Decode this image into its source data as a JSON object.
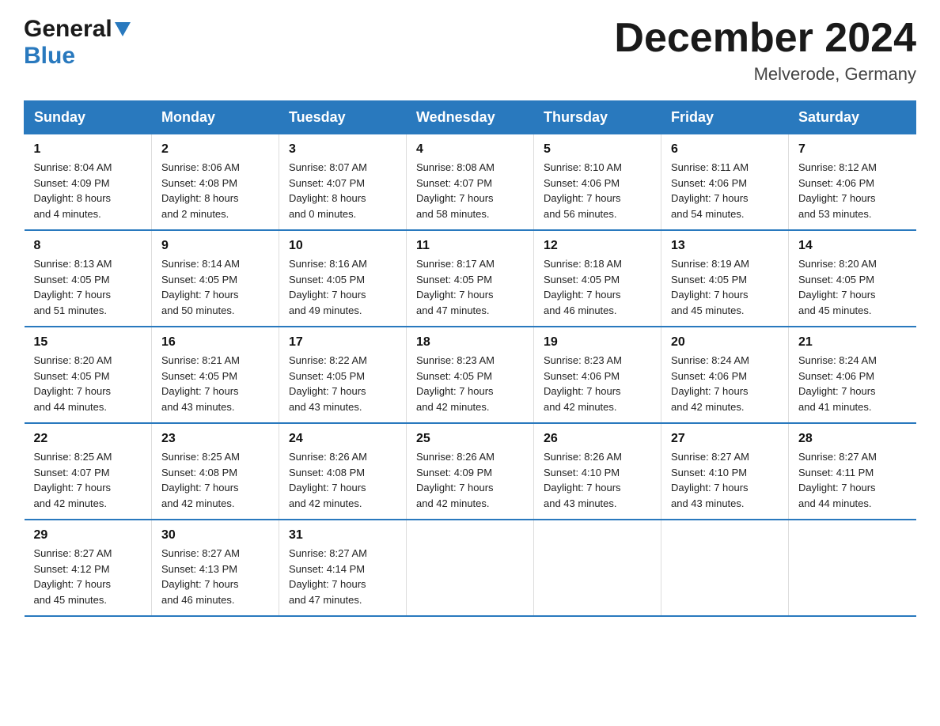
{
  "logo": {
    "general": "General",
    "blue": "Blue"
  },
  "title": "December 2024",
  "location": "Melverode, Germany",
  "weekdays": [
    "Sunday",
    "Monday",
    "Tuesday",
    "Wednesday",
    "Thursday",
    "Friday",
    "Saturday"
  ],
  "weeks": [
    [
      {
        "day": "1",
        "info": "Sunrise: 8:04 AM\nSunset: 4:09 PM\nDaylight: 8 hours\nand 4 minutes."
      },
      {
        "day": "2",
        "info": "Sunrise: 8:06 AM\nSunset: 4:08 PM\nDaylight: 8 hours\nand 2 minutes."
      },
      {
        "day": "3",
        "info": "Sunrise: 8:07 AM\nSunset: 4:07 PM\nDaylight: 8 hours\nand 0 minutes."
      },
      {
        "day": "4",
        "info": "Sunrise: 8:08 AM\nSunset: 4:07 PM\nDaylight: 7 hours\nand 58 minutes."
      },
      {
        "day": "5",
        "info": "Sunrise: 8:10 AM\nSunset: 4:06 PM\nDaylight: 7 hours\nand 56 minutes."
      },
      {
        "day": "6",
        "info": "Sunrise: 8:11 AM\nSunset: 4:06 PM\nDaylight: 7 hours\nand 54 minutes."
      },
      {
        "day": "7",
        "info": "Sunrise: 8:12 AM\nSunset: 4:06 PM\nDaylight: 7 hours\nand 53 minutes."
      }
    ],
    [
      {
        "day": "8",
        "info": "Sunrise: 8:13 AM\nSunset: 4:05 PM\nDaylight: 7 hours\nand 51 minutes."
      },
      {
        "day": "9",
        "info": "Sunrise: 8:14 AM\nSunset: 4:05 PM\nDaylight: 7 hours\nand 50 minutes."
      },
      {
        "day": "10",
        "info": "Sunrise: 8:16 AM\nSunset: 4:05 PM\nDaylight: 7 hours\nand 49 minutes."
      },
      {
        "day": "11",
        "info": "Sunrise: 8:17 AM\nSunset: 4:05 PM\nDaylight: 7 hours\nand 47 minutes."
      },
      {
        "day": "12",
        "info": "Sunrise: 8:18 AM\nSunset: 4:05 PM\nDaylight: 7 hours\nand 46 minutes."
      },
      {
        "day": "13",
        "info": "Sunrise: 8:19 AM\nSunset: 4:05 PM\nDaylight: 7 hours\nand 45 minutes."
      },
      {
        "day": "14",
        "info": "Sunrise: 8:20 AM\nSunset: 4:05 PM\nDaylight: 7 hours\nand 45 minutes."
      }
    ],
    [
      {
        "day": "15",
        "info": "Sunrise: 8:20 AM\nSunset: 4:05 PM\nDaylight: 7 hours\nand 44 minutes."
      },
      {
        "day": "16",
        "info": "Sunrise: 8:21 AM\nSunset: 4:05 PM\nDaylight: 7 hours\nand 43 minutes."
      },
      {
        "day": "17",
        "info": "Sunrise: 8:22 AM\nSunset: 4:05 PM\nDaylight: 7 hours\nand 43 minutes."
      },
      {
        "day": "18",
        "info": "Sunrise: 8:23 AM\nSunset: 4:05 PM\nDaylight: 7 hours\nand 42 minutes."
      },
      {
        "day": "19",
        "info": "Sunrise: 8:23 AM\nSunset: 4:06 PM\nDaylight: 7 hours\nand 42 minutes."
      },
      {
        "day": "20",
        "info": "Sunrise: 8:24 AM\nSunset: 4:06 PM\nDaylight: 7 hours\nand 42 minutes."
      },
      {
        "day": "21",
        "info": "Sunrise: 8:24 AM\nSunset: 4:06 PM\nDaylight: 7 hours\nand 41 minutes."
      }
    ],
    [
      {
        "day": "22",
        "info": "Sunrise: 8:25 AM\nSunset: 4:07 PM\nDaylight: 7 hours\nand 42 minutes."
      },
      {
        "day": "23",
        "info": "Sunrise: 8:25 AM\nSunset: 4:08 PM\nDaylight: 7 hours\nand 42 minutes."
      },
      {
        "day": "24",
        "info": "Sunrise: 8:26 AM\nSunset: 4:08 PM\nDaylight: 7 hours\nand 42 minutes."
      },
      {
        "day": "25",
        "info": "Sunrise: 8:26 AM\nSunset: 4:09 PM\nDaylight: 7 hours\nand 42 minutes."
      },
      {
        "day": "26",
        "info": "Sunrise: 8:26 AM\nSunset: 4:10 PM\nDaylight: 7 hours\nand 43 minutes."
      },
      {
        "day": "27",
        "info": "Sunrise: 8:27 AM\nSunset: 4:10 PM\nDaylight: 7 hours\nand 43 minutes."
      },
      {
        "day": "28",
        "info": "Sunrise: 8:27 AM\nSunset: 4:11 PM\nDaylight: 7 hours\nand 44 minutes."
      }
    ],
    [
      {
        "day": "29",
        "info": "Sunrise: 8:27 AM\nSunset: 4:12 PM\nDaylight: 7 hours\nand 45 minutes."
      },
      {
        "day": "30",
        "info": "Sunrise: 8:27 AM\nSunset: 4:13 PM\nDaylight: 7 hours\nand 46 minutes."
      },
      {
        "day": "31",
        "info": "Sunrise: 8:27 AM\nSunset: 4:14 PM\nDaylight: 7 hours\nand 47 minutes."
      },
      null,
      null,
      null,
      null
    ]
  ]
}
